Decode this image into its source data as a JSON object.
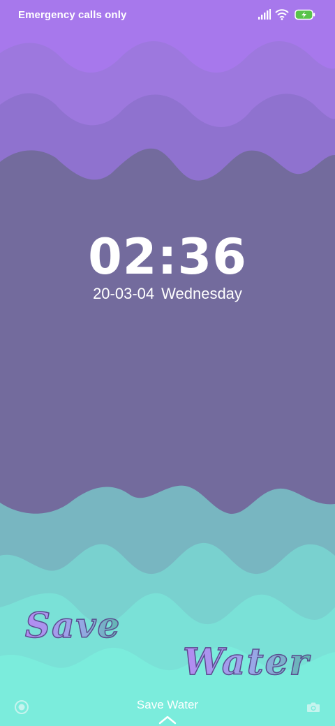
{
  "status_bar": {
    "carrier_text": "Emergency calls only",
    "icons": [
      "signal-icon",
      "wifi-icon",
      "battery-charging-icon"
    ],
    "battery_color": "#58c34a"
  },
  "lockscreen": {
    "time": "02:36",
    "date": "20-03-04",
    "weekday": "Wednesday"
  },
  "wallpaper": {
    "slogan_line1": "Save",
    "slogan_line2": "Water",
    "colors": {
      "top": "#a778ec",
      "band_light": "#9d78de",
      "band_mid": "#8f72cf",
      "center": "#736b9d",
      "teal_dark": "#78b6c1",
      "teal_mid": "#79d1cf",
      "teal_light": "#7ae1d7",
      "bottom": "#7becdc"
    }
  },
  "bottom_bar": {
    "label": "Save Water",
    "left_icon": "record-icon",
    "right_icon": "camera-icon"
  }
}
